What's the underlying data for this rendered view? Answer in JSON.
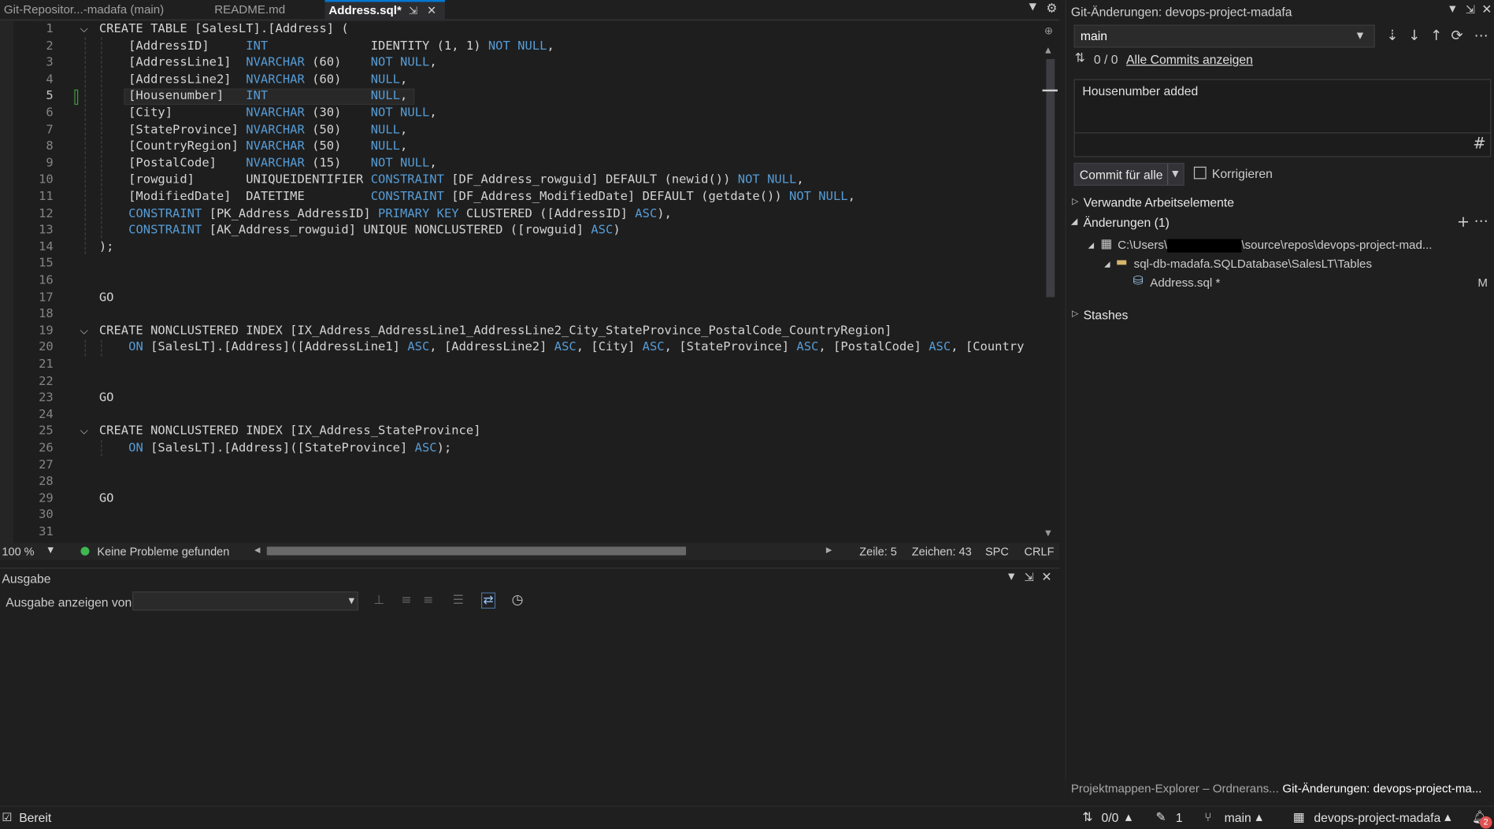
{
  "tabs": [
    {
      "label": "Git-Repositor...-madafa (main)"
    },
    {
      "label": "README.md"
    },
    {
      "label": "Address.sql*",
      "pin": "⇲",
      "close": "✕"
    }
  ],
  "editor": {
    "current_line": 5,
    "lines": [
      {
        "n": "1",
        "code": "CREATE TABLE [SalesLT].[Address] ("
      },
      {
        "n": "2",
        "code": "    [AddressID]     INT              IDENTITY (1, 1) NOT NULL,"
      },
      {
        "n": "3",
        "code": "    [AddressLine1]  NVARCHAR (60)    NOT NULL,"
      },
      {
        "n": "4",
        "code": "    [AddressLine2]  NVARCHAR (60)    NULL,"
      },
      {
        "n": "5",
        "code": "    [Housenumber]   INT              NULL,"
      },
      {
        "n": "6",
        "code": "    [City]          NVARCHAR (30)    NOT NULL,"
      },
      {
        "n": "7",
        "code": "    [StateProvince] NVARCHAR (50)    NULL,"
      },
      {
        "n": "8",
        "code": "    [CountryRegion] NVARCHAR (50)    NULL,"
      },
      {
        "n": "9",
        "code": "    [PostalCode]    NVARCHAR (15)    NOT NULL,"
      },
      {
        "n": "10",
        "code": "    [rowguid]       UNIQUEIDENTIFIER CONSTRAINT [DF_Address_rowguid] DEFAULT (newid()) NOT NULL,"
      },
      {
        "n": "11",
        "code": "    [ModifiedDate]  DATETIME         CONSTRAINT [DF_Address_ModifiedDate] DEFAULT (getdate()) NOT NULL,"
      },
      {
        "n": "12",
        "code": "    CONSTRAINT [PK_Address_AddressID] PRIMARY KEY CLUSTERED ([AddressID] ASC),"
      },
      {
        "n": "13",
        "code": "    CONSTRAINT [AK_Address_rowguid] UNIQUE NONCLUSTERED ([rowguid] ASC)"
      },
      {
        "n": "14",
        "code": ");"
      },
      {
        "n": "15",
        "code": ""
      },
      {
        "n": "16",
        "code": ""
      },
      {
        "n": "17",
        "code": "GO"
      },
      {
        "n": "18",
        "code": ""
      },
      {
        "n": "19",
        "code": "CREATE NONCLUSTERED INDEX [IX_Address_AddressLine1_AddressLine2_City_StateProvince_PostalCode_CountryRegion]"
      },
      {
        "n": "20",
        "code": "    ON [SalesLT].[Address]([AddressLine1] ASC, [AddressLine2] ASC, [City] ASC, [StateProvince] ASC, [PostalCode] ASC, [Country"
      },
      {
        "n": "21",
        "code": ""
      },
      {
        "n": "22",
        "code": ""
      },
      {
        "n": "23",
        "code": "GO"
      },
      {
        "n": "24",
        "code": ""
      },
      {
        "n": "25",
        "code": "CREATE NONCLUSTERED INDEX [IX_Address_StateProvince]"
      },
      {
        "n": "26",
        "code": "    ON [SalesLT].[Address]([StateProvince] ASC);"
      },
      {
        "n": "27",
        "code": ""
      },
      {
        "n": "28",
        "code": ""
      },
      {
        "n": "29",
        "code": "GO"
      },
      {
        "n": "30",
        "code": ""
      },
      {
        "n": "31",
        "code": ""
      }
    ],
    "keywords": [
      "CONSTRAINT",
      "PRIMARY",
      "KEY",
      "ASC",
      "NOT",
      "NULL",
      "INT",
      "NVARCHAR",
      "ON"
    ]
  },
  "editor_status": {
    "zoom": "100 %",
    "issues": "Keine Probleme gefunden",
    "line": "Zeile: 5",
    "char": "Zeichen: 43",
    "spc": "SPC",
    "eol": "CRLF"
  },
  "output": {
    "title": "Ausgabe",
    "show_from_label": "Ausgabe anzeigen von:",
    "show_from_value": ""
  },
  "git": {
    "title": "Git-Änderungen: devops-project-madafa",
    "branch": "main",
    "sync_counts": "0 / 0",
    "all_commits_link": "Alle Commits anzeigen",
    "commit_message": "Housenumber added",
    "commit_button": "Commit für alle",
    "amend_label": "Korrigieren",
    "related_items": "Verwandte Arbeitselemente",
    "changes_header": "Änderungen (1)",
    "path_prefix": "C:\\Users\\",
    "path_suffix": "\\source\\repos\\devops-project-mad...",
    "folder": "sql-db-madafa.SQLDatabase\\SalesLT\\Tables",
    "file": "Address.sql *",
    "file_status": "M",
    "stashes": "Stashes"
  },
  "bottom_tabs": [
    {
      "label": "Projektmappen-Explorer – Ordnerans..."
    },
    {
      "label": "Git-Änderungen: devops-project-ma..."
    }
  ],
  "statusbar": {
    "ready": "Bereit",
    "sync": "0/0",
    "pending": "1",
    "branch": "main",
    "repo": "devops-project-madafa",
    "notifications": "2"
  },
  "colors": {
    "accent": "#0078d4",
    "keyword": "#569cd6",
    "editor_bg": "#1e1e1e",
    "ok_green": "#3fb950",
    "badge_red": "#e05252"
  }
}
